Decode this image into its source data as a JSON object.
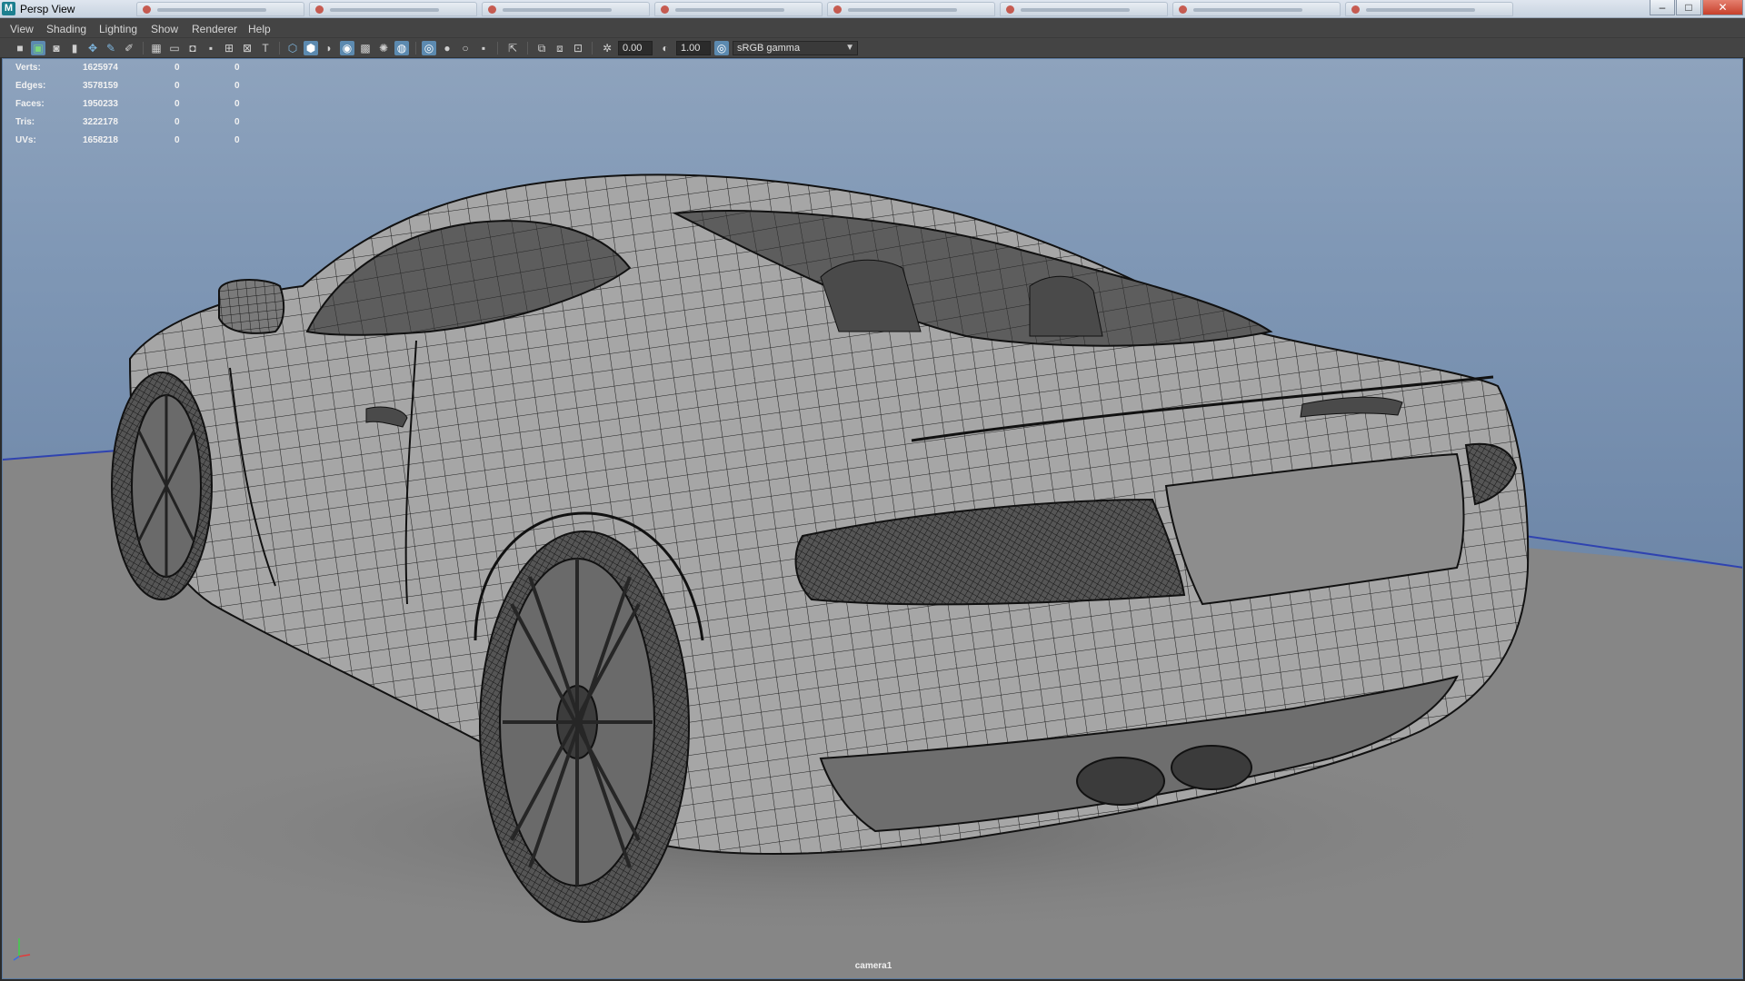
{
  "window": {
    "app_icon": "M",
    "title": "Persp View",
    "controls": {
      "minimize": "–",
      "maximize": "□",
      "close": "✕"
    }
  },
  "menu": {
    "items": [
      {
        "label": "View"
      },
      {
        "label": "Shading"
      },
      {
        "label": "Lighting"
      },
      {
        "label": "Show"
      },
      {
        "label": "Renderer"
      },
      {
        "label": "Help"
      }
    ]
  },
  "toolbar": {
    "exposure_value": "0.00",
    "gamma_value": "1.00",
    "color_space": "sRGB gamma",
    "icons": [
      "camera-icon",
      "camera-attributes-icon",
      "bookmark-camera-icon",
      "image-plane-icon",
      "2d-pan-zoom-icon",
      "grease-pencil-icon",
      "grid-icon",
      "film-gate-icon",
      "resolution-gate-icon",
      "gate-mask-icon",
      "field-chart-icon",
      "safe-action-icon",
      "safe-title-icon",
      "wireframe-icon",
      "smooth-shade-icon",
      "wireframe-on-shaded-icon",
      "textured-icon",
      "lights-icon",
      "shadows-icon",
      "screen-space-ao-icon",
      "motion-blur-icon",
      "multisample-aa-icon",
      "depth-of-field-icon",
      "isolate-select-icon",
      "xray-icon",
      "xray-joints-icon",
      "xray-components-icon",
      "exposure-icon",
      "gamma-icon",
      "color-management-icon"
    ]
  },
  "hud": {
    "rows": [
      {
        "label": "Verts:",
        "v1": "1625974",
        "v2": "0",
        "v3": "0"
      },
      {
        "label": "Edges:",
        "v1": "3578159",
        "v2": "0",
        "v3": "0"
      },
      {
        "label": "Faces:",
        "v1": "1950233",
        "v2": "0",
        "v3": "0"
      },
      {
        "label": "Tris:",
        "v1": "3222178",
        "v2": "0",
        "v3": "0"
      },
      {
        "label": "UVs:",
        "v1": "1658218",
        "v2": "0",
        "v3": "0"
      }
    ]
  },
  "viewport": {
    "camera_name": "camera1",
    "colors": {
      "sky": "#7f97b5",
      "ground": "#868686",
      "horizon_line": "#2f43b0",
      "wire": "#1c1c1c",
      "body": "#a4a4a4"
    }
  }
}
